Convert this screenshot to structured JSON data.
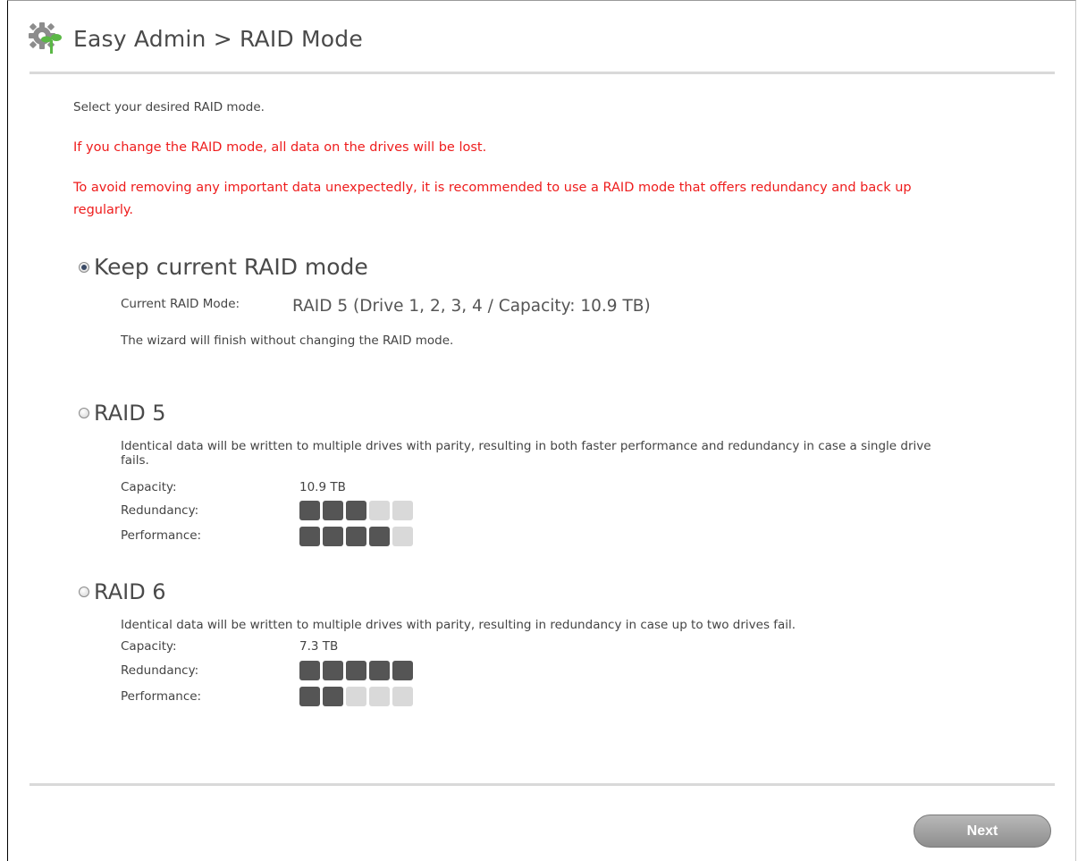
{
  "header": {
    "title": "Easy Admin > RAID Mode",
    "icon": "gear-plant-icon"
  },
  "instruction": "Select your desired RAID mode.",
  "warnings": [
    "If you change the RAID mode, all data on the drives will be lost.",
    "To avoid removing any important data unexpectedly, it is recommended to use a RAID mode that offers redundancy and back up regularly."
  ],
  "options": {
    "keep": {
      "label": "Keep current RAID mode",
      "checked": true,
      "current_label": "Current RAID Mode:",
      "current_value": "RAID 5 (Drive 1, 2, 3, 4 / Capacity: 10.9 TB)",
      "note": "The wizard will finish without changing the RAID mode."
    },
    "raid5": {
      "label": "RAID 5",
      "checked": false,
      "description": "Identical data will be written to multiple drives with parity, resulting in both faster performance and redundancy in case a single drive fails.",
      "capacity_label": "Capacity:",
      "capacity": "10.9 TB",
      "redundancy_label": "Redundancy:",
      "redundancy_level": 3,
      "performance_label": "Performance:",
      "performance_level": 4,
      "max_level": 5
    },
    "raid6": {
      "label": "RAID 6",
      "checked": false,
      "description": "Identical data will be written to multiple drives with parity, resulting in redundancy in case up to two drives fail.",
      "capacity_label": "Capacity:",
      "capacity": "7.3 TB",
      "redundancy_label": "Redundancy:",
      "redundancy_level": 5,
      "performance_label": "Performance:",
      "performance_level": 2,
      "max_level": 5
    }
  },
  "buttons": {
    "next": "Next"
  },
  "colors": {
    "warning": "#ee1c1c",
    "meter_on": "#555555",
    "meter_off": "#d9d9d9"
  }
}
